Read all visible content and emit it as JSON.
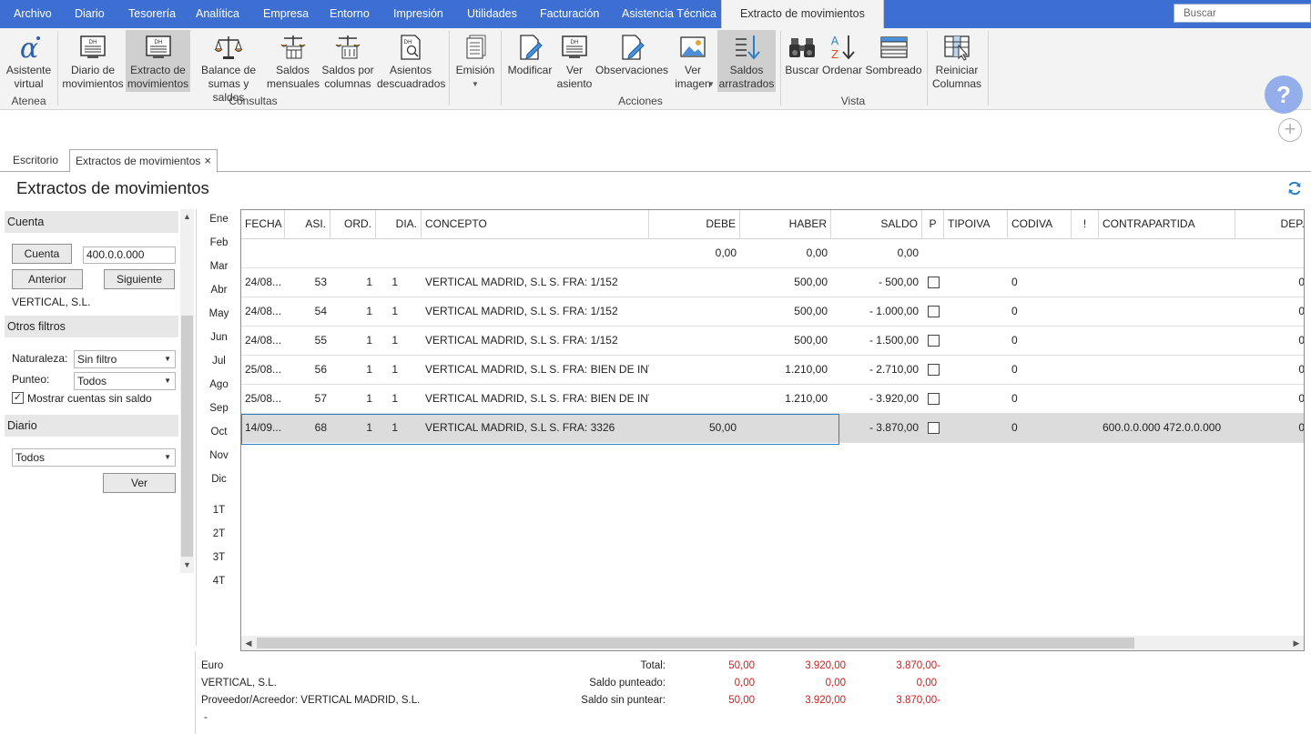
{
  "menu": {
    "items": [
      "Archivo",
      "Diario",
      "Tesorería",
      "Analítica",
      "Empresa",
      "Entorno",
      "Impresión",
      "Utilidades",
      "Facturación",
      "Asistencia Técnica",
      "Extracto de movimientos"
    ],
    "search_placeholder": "Buscar"
  },
  "ribbon": {
    "buttons": {
      "asistente": "Asistente virtual",
      "diario": "Diario de movimientos",
      "extracto": "Extracto de movimientos",
      "balance": "Balance de sumas y saldos",
      "saldos_mensuales": "Saldos mensuales",
      "saldos_columnas": "Saldos por columnas",
      "asientos_descuadrados": "Asientos descuadrados",
      "emision": "Emisión",
      "modificar": "Modificar",
      "ver_asiento": "Ver asiento",
      "observaciones": "Observaciones",
      "ver_imagen": "Ver imagen",
      "saldos_arrastrados": "Saldos arrastrados",
      "buscar": "Buscar",
      "ordenar": "Ordenar",
      "sombreado": "Sombreado",
      "reiniciar": "Reiniciar Columnas"
    },
    "groups": {
      "atenea": "Atenea",
      "consultas": "Consultas",
      "acciones": "Acciones",
      "vista": "Vista"
    },
    "help": "?"
  },
  "tabs": {
    "escritorio": "Escritorio",
    "extractos": "Extractos de movimientos",
    "close": "×"
  },
  "page_title": "Extractos de movimientos",
  "left": {
    "cuenta_header": "Cuenta",
    "cuenta_button": "Cuenta",
    "cuenta_value": "400.0.0.000",
    "anterior": "Anterior",
    "siguiente": "Siguiente",
    "cuenta_name": "VERTICAL, S.L.",
    "otros_header": "Otros filtros",
    "naturaleza_label": "Naturaleza:",
    "naturaleza_value": "Sin filtro",
    "punteo_label": "Punteo:",
    "punteo_value": "Todos",
    "mostrar_label": "Mostrar cuentas sin saldo",
    "mostrar_checked": "✓",
    "diario_header": "Diario",
    "diario_value": "Todos",
    "ver_button": "Ver"
  },
  "months": [
    "Ene",
    "Feb",
    "Mar",
    "Abr",
    "May",
    "Jun",
    "Jul",
    "Ago",
    "Sep",
    "Oct",
    "Nov",
    "Dic"
  ],
  "quarters": [
    "1T",
    "2T",
    "3T",
    "4T"
  ],
  "grid": {
    "columns": [
      "FECHA",
      "ASI.",
      "ORD.",
      "DIA.",
      "CONCEPTO",
      "DEBE",
      "HABER",
      "SALDO",
      "P",
      "TIPOIVA",
      "CODIVA",
      "!",
      "CONTRAPARTIDA",
      "DEP."
    ],
    "opening": {
      "debe": "0,00",
      "haber": "0,00",
      "saldo": "0,00"
    },
    "rows": [
      {
        "fecha": "24/08...",
        "asi": "53",
        "ord": "1",
        "dia": "1",
        "concepto": "VERTICAL MADRID, S.L S. FRA:  1/152",
        "debe": "",
        "haber": "500,00",
        "saldo": "- 500,00",
        "codiva": "0",
        "contrapartida": "",
        "dep": "0"
      },
      {
        "fecha": "24/08...",
        "asi": "54",
        "ord": "1",
        "dia": "1",
        "concepto": "VERTICAL MADRID, S.L S. FRA:  1/152",
        "debe": "",
        "haber": "500,00",
        "saldo": "- 1.000,00",
        "codiva": "0",
        "contrapartida": "",
        "dep": "0"
      },
      {
        "fecha": "24/08...",
        "asi": "55",
        "ord": "1",
        "dia": "1",
        "concepto": "VERTICAL MADRID, S.L S. FRA:  1/152",
        "debe": "",
        "haber": "500,00",
        "saldo": "- 1.500,00",
        "codiva": "0",
        "contrapartida": "",
        "dep": "0"
      },
      {
        "fecha": "25/08...",
        "asi": "56",
        "ord": "1",
        "dia": "1",
        "concepto": "VERTICAL MADRID, S.L S. FRA:  BIEN DE INV...",
        "debe": "",
        "haber": "1.210,00",
        "saldo": "- 2.710,00",
        "codiva": "0",
        "contrapartida": "",
        "dep": "0"
      },
      {
        "fecha": "25/08...",
        "asi": "57",
        "ord": "1",
        "dia": "1",
        "concepto": "VERTICAL MADRID, S.L S. FRA:  BIEN DE INV...",
        "debe": "",
        "haber": "1.210,00",
        "saldo": "- 3.920,00",
        "codiva": "0",
        "contrapartida": "",
        "dep": "0"
      },
      {
        "fecha": "14/09...",
        "asi": "68",
        "ord": "1",
        "dia": "1",
        "concepto": "VERTICAL MADRID, S.L S. FRA:  3326",
        "debe": "50,00",
        "haber": "",
        "saldo": "- 3.870,00",
        "codiva": "0",
        "contrapartida": "600.0.0.000 472.0.0.000",
        "dep": "0"
      }
    ]
  },
  "footer": {
    "currency": "Euro",
    "company": "VERTICAL, S.L.",
    "proveedor": "Proveedor/Acreedor: VERTICAL MADRID, S.L.",
    "dash": "-",
    "total_label": "Total:",
    "punteado_label": "Saldo punteado:",
    "sin_puntear_label": "Saldo sin puntear:",
    "total": [
      "50,00",
      "3.920,00",
      "3.870,00-"
    ],
    "punteado": [
      "0,00",
      "0,00",
      "0,00"
    ],
    "sin_puntear": [
      "50,00",
      "3.920,00",
      "3.870,00-"
    ]
  },
  "colors": {
    "menu_bar": "#3c6fd1",
    "accent": "#2b7fc4",
    "negative": "#e01414"
  }
}
